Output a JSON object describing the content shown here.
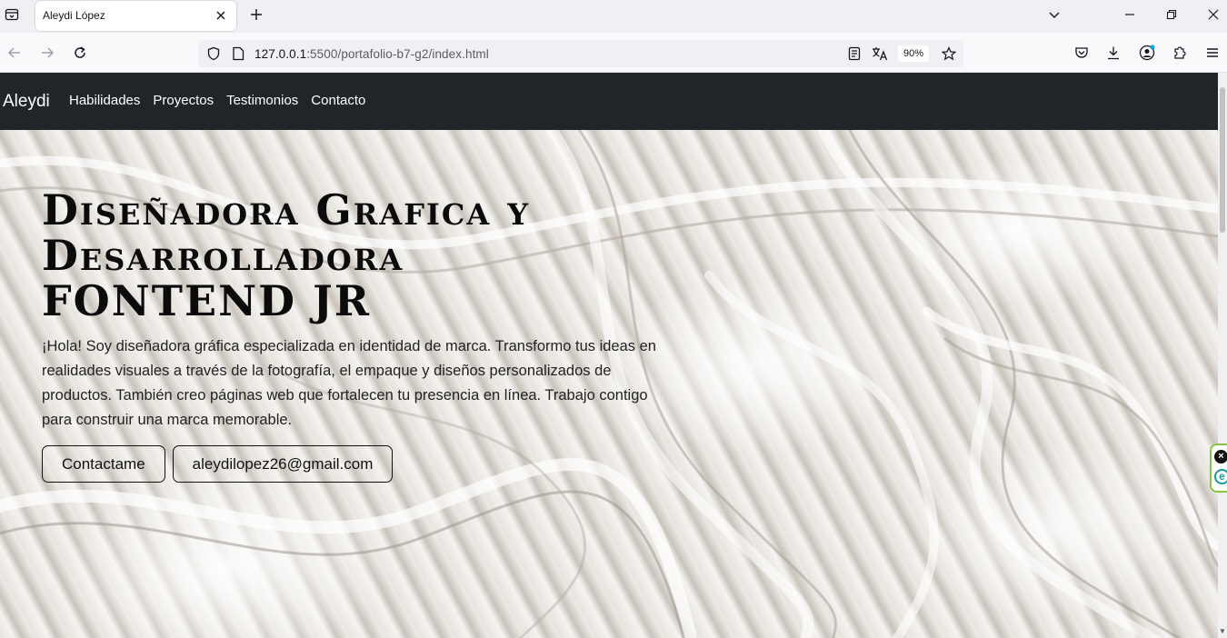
{
  "browser": {
    "tab_title": "Aleydi López",
    "url_host": "127.0.0.1",
    "url_rest": ":5500/portafolio-b7-g2/index.html",
    "zoom": "90%"
  },
  "site": {
    "brand": "Aleydi",
    "nav": [
      "Habilidades",
      "Proyectos",
      "Testimonios",
      "Contacto"
    ]
  },
  "hero": {
    "title_line1": "Diseñadora Grafica y",
    "title_line2": "Desarrolladora",
    "title_line3": "FONTEND JR",
    "text": "¡Hola! Soy diseñadora gráfica especializada en identidad de marca. Transformo tus ideas en realidades visuales a través de la fotografía, el empaque y diseños personalizados de productos. También creo páginas web que fortalecen tu presencia en línea. Trabajo contigo para construir una marca memorable.",
    "btn_contact": "Contactame",
    "btn_email": "aleydilopez26@gmail.com"
  },
  "icons": {
    "tab_list": "tab-list-icon",
    "close": "close-icon",
    "new_tab": "plus-icon",
    "back": "back-arrow-icon",
    "forward": "forward-arrow-icon",
    "reload": "reload-icon",
    "shield": "shield-icon",
    "page": "page-icon",
    "reader": "reader-view-icon",
    "translate": "translate-icon",
    "star": "star-icon",
    "pocket": "pocket-icon",
    "download": "download-icon",
    "account": "account-icon",
    "extensions": "puzzle-icon",
    "menu": "hamburger-icon"
  }
}
